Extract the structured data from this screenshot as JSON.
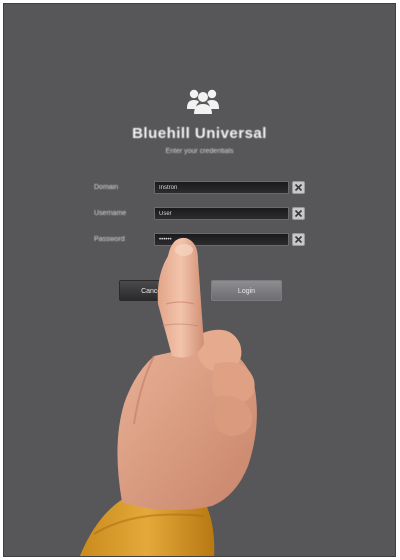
{
  "app": {
    "title": "Bluehill Universal",
    "subtitle": "Enter your credentials"
  },
  "form": {
    "fields": [
      {
        "label": "Domain",
        "value": "Instron"
      },
      {
        "label": "Username",
        "value": "User"
      },
      {
        "label": "Password",
        "value": "••••••"
      }
    ]
  },
  "buttons": {
    "cancel_label": "Cancel",
    "login_label": "Login"
  },
  "colors": {
    "background": "#57575a",
    "input_background": "#222224",
    "accent": "#8d8d90"
  },
  "icons": {
    "logo": "users-group-icon",
    "clear": "close-icon"
  }
}
